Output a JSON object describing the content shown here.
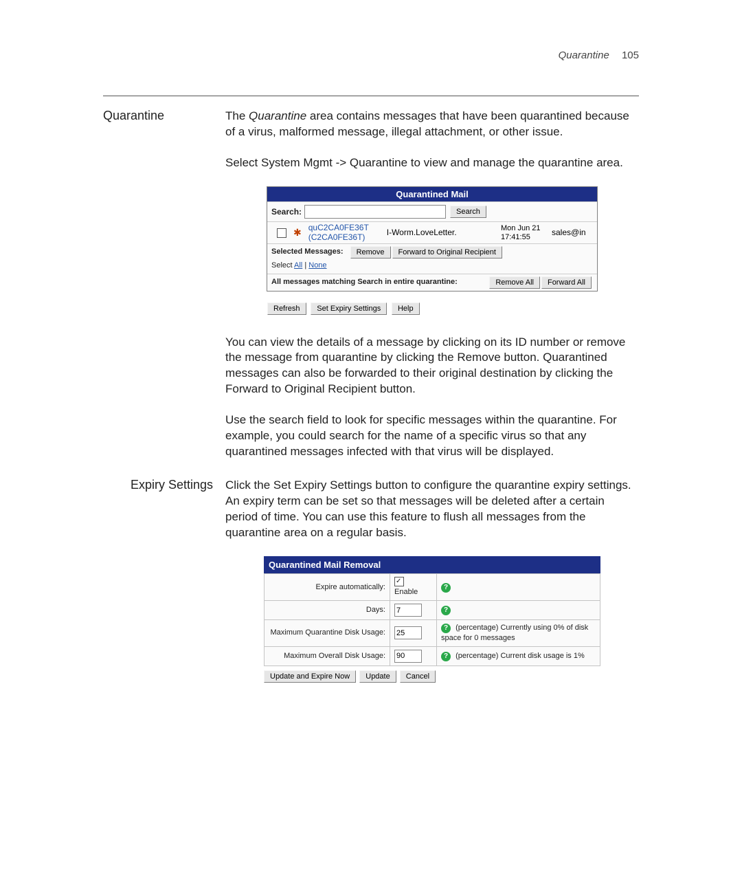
{
  "header": {
    "section": "Quarantine",
    "page": "105"
  },
  "sections": {
    "quarantine": {
      "heading": "Quarantine",
      "p1a": "The ",
      "p1b": "Quarantine",
      "p1c": " area contains messages that have been quarantined because of a virus, malformed message, illegal attachment, or other issue.",
      "p2a": "Select ",
      "p2b": "System Mgmt -> Quarantine",
      "p2c": " to view and manage the quarantine area.",
      "p3a": "You can view the details of a message by clicking on its ID number or remove the message from quarantine by clicking the ",
      "p3b": "Remove",
      "p3c": " button. Quarantined messages can also be forwarded to their original destination by clicking the ",
      "p3d": "Forward to Original Recipient",
      "p3e": " button.",
      "p4": "Use the search field to look for specific messages within the quarantine. For example, you could search for the name of a specific virus so that any quarantined messages infected with that virus will be displayed."
    },
    "expiry": {
      "heading": "Expiry Settings",
      "p1a": "Click the ",
      "p1b": "Set Expiry Settings",
      "p1c": " button to configure the quarantine expiry settings. An expiry term can be set so that messages will be deleted after a certain period of time. You can use this feature to flush all messages from the quarantine area on a regular basis."
    }
  },
  "panel1": {
    "title": "Quarantined Mail",
    "search_label": "Search:",
    "search_value": "",
    "search_btn": "Search",
    "row": {
      "id_line1": "quC2CA0FE36T",
      "id_line2": "(C2CA0FE36T)",
      "virus": "I-Worm.LoveLetter.",
      "date": "Mon Jun 21 17:41:55",
      "mail": "sales@in"
    },
    "sel_label": "Selected Messages:",
    "btn_remove": "Remove",
    "btn_forward": "Forward to Original Recipient",
    "select_prefix": "Select ",
    "select_all": "All",
    "select_sep": " | ",
    "select_none": "None",
    "all_label": "All messages matching Search in entire quarantine:",
    "btn_remove_all": "Remove All",
    "btn_forward_all": "Forward All",
    "btn_refresh": "Refresh",
    "btn_setexpiry": "Set Expiry Settings",
    "btn_help": "Help"
  },
  "panel2": {
    "title": "Quarantined Mail Removal",
    "r1_label": "Expire automatically:",
    "r1_enable": "Enable",
    "r2_label": "Days:",
    "r2_value": "7",
    "r3_label": "Maximum Quarantine Disk Usage:",
    "r3_value": "25",
    "r3_info": "(percentage)  Currently using 0% of disk space for 0 messages",
    "r4_label": "Maximum Overall Disk Usage:",
    "r4_value": "90",
    "r4_info": "(percentage)  Current disk usage is 1%",
    "btn_update_expire": "Update and Expire Now",
    "btn_update": "Update",
    "btn_cancel": "Cancel",
    "qmark": "?"
  }
}
